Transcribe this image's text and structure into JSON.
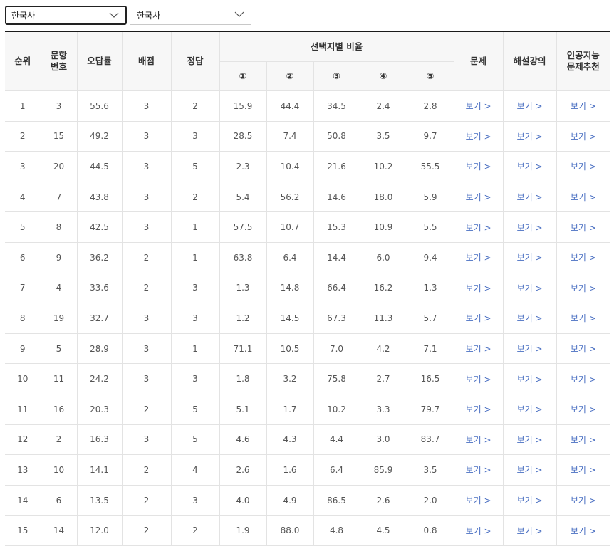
{
  "filters": [
    {
      "selected": "한국사"
    },
    {
      "selected": "한국사"
    }
  ],
  "table": {
    "headers": {
      "rank": "순위",
      "question_no": [
        "문항",
        "번호"
      ],
      "wrong_rate": "오답률",
      "points": "배점",
      "answer": "정답",
      "choice_ratio": "선택지별 비율",
      "choices": [
        "①",
        "②",
        "③",
        "④",
        "⑤"
      ],
      "problem": "문제",
      "lecture": "해설강의",
      "ai": [
        "인공지능",
        "문제추천"
      ]
    },
    "link_label": "보기 >",
    "rows": [
      {
        "rank": "1",
        "q": "3",
        "wrong": "55.6",
        "pts": "3",
        "ans": "2",
        "c": [
          "15.9",
          "44.4",
          "34.5",
          "2.4",
          "2.8"
        ]
      },
      {
        "rank": "2",
        "q": "15",
        "wrong": "49.2",
        "pts": "3",
        "ans": "3",
        "c": [
          "28.5",
          "7.4",
          "50.8",
          "3.5",
          "9.7"
        ]
      },
      {
        "rank": "3",
        "q": "20",
        "wrong": "44.5",
        "pts": "3",
        "ans": "5",
        "c": [
          "2.3",
          "10.4",
          "21.6",
          "10.2",
          "55.5"
        ]
      },
      {
        "rank": "4",
        "q": "7",
        "wrong": "43.8",
        "pts": "3",
        "ans": "2",
        "c": [
          "5.4",
          "56.2",
          "14.6",
          "18.0",
          "5.9"
        ]
      },
      {
        "rank": "5",
        "q": "8",
        "wrong": "42.5",
        "pts": "3",
        "ans": "1",
        "c": [
          "57.5",
          "10.7",
          "15.3",
          "10.9",
          "5.5"
        ]
      },
      {
        "rank": "6",
        "q": "9",
        "wrong": "36.2",
        "pts": "2",
        "ans": "1",
        "c": [
          "63.8",
          "6.4",
          "14.4",
          "6.0",
          "9.4"
        ]
      },
      {
        "rank": "7",
        "q": "4",
        "wrong": "33.6",
        "pts": "2",
        "ans": "3",
        "c": [
          "1.3",
          "14.8",
          "66.4",
          "16.2",
          "1.3"
        ]
      },
      {
        "rank": "8",
        "q": "19",
        "wrong": "32.7",
        "pts": "3",
        "ans": "3",
        "c": [
          "1.2",
          "14.5",
          "67.3",
          "11.3",
          "5.7"
        ]
      },
      {
        "rank": "9",
        "q": "5",
        "wrong": "28.9",
        "pts": "3",
        "ans": "1",
        "c": [
          "71.1",
          "10.5",
          "7.0",
          "4.2",
          "7.1"
        ]
      },
      {
        "rank": "10",
        "q": "11",
        "wrong": "24.2",
        "pts": "3",
        "ans": "3",
        "c": [
          "1.8",
          "3.2",
          "75.8",
          "2.7",
          "16.5"
        ]
      },
      {
        "rank": "11",
        "q": "16",
        "wrong": "20.3",
        "pts": "2",
        "ans": "5",
        "c": [
          "5.1",
          "1.7",
          "10.2",
          "3.3",
          "79.7"
        ]
      },
      {
        "rank": "12",
        "q": "2",
        "wrong": "16.3",
        "pts": "3",
        "ans": "5",
        "c": [
          "4.6",
          "4.3",
          "4.4",
          "3.0",
          "83.7"
        ]
      },
      {
        "rank": "13",
        "q": "10",
        "wrong": "14.1",
        "pts": "2",
        "ans": "4",
        "c": [
          "2.6",
          "1.6",
          "6.4",
          "85.9",
          "3.5"
        ]
      },
      {
        "rank": "14",
        "q": "6",
        "wrong": "13.5",
        "pts": "2",
        "ans": "3",
        "c": [
          "4.0",
          "4.9",
          "86.5",
          "2.6",
          "2.0"
        ]
      },
      {
        "rank": "15",
        "q": "14",
        "wrong": "12.0",
        "pts": "2",
        "ans": "2",
        "c": [
          "1.9",
          "88.0",
          "4.8",
          "4.5",
          "0.8"
        ]
      }
    ]
  }
}
